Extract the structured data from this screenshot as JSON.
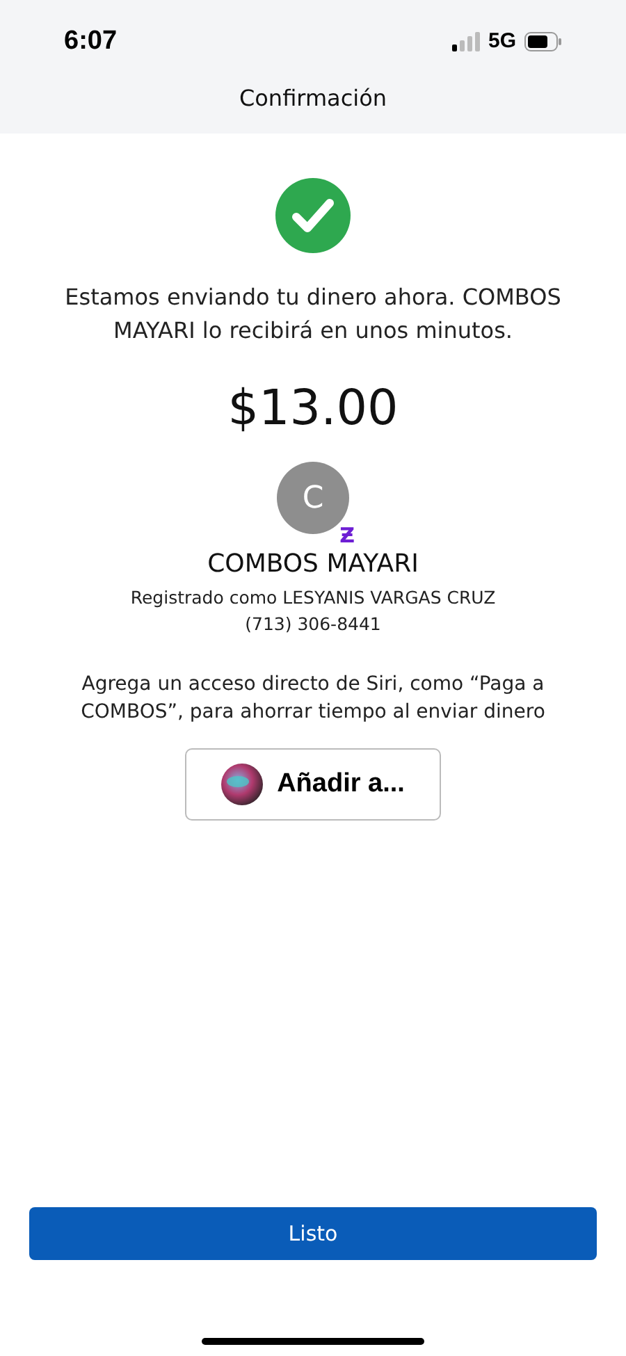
{
  "status_bar": {
    "time": "6:07",
    "network": "5G"
  },
  "header": {
    "title": "Confirmación"
  },
  "message": "Estamos enviando tu dinero ahora. COMBOS MAYARI lo recibirá en unos minutos.",
  "amount": "$13.00",
  "recipient": {
    "initial": "C",
    "badge": "Ƶ",
    "name": "COMBOS MAYARI",
    "registered": "Registrado como LESYANIS VARGAS CRUZ",
    "phone": "(713) 306-8441"
  },
  "siri": {
    "text": "Agrega un acceso directo de Siri, como “Paga a COMBOS”, para ahorrar tiempo al enviar dinero",
    "button": "Añadir a..."
  },
  "done_button": "Listo"
}
